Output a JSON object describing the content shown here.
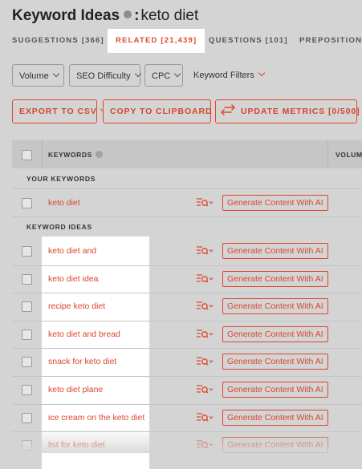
{
  "header": {
    "title_main": "Keyword Ideas",
    "title_sep": ":",
    "title_query": "keto diet"
  },
  "tabs": [
    {
      "label": "SUGGESTIONS [366]",
      "active": false
    },
    {
      "label": "RELATED [21,439]",
      "active": true
    },
    {
      "label": "QUESTIONS [101]",
      "active": false
    },
    {
      "label": "PREPOSITIONS",
      "active": false
    }
  ],
  "filters": {
    "volume": "Volume",
    "seo_difficulty": "SEO Difficulty",
    "cpc": "CPC",
    "keyword_filters": "Keyword Filters"
  },
  "actions": {
    "export": "EXPORT TO CSV",
    "clipboard": "COPY TO CLIPBOARD",
    "update": "UPDATE METRICS [0/500]"
  },
  "table": {
    "col_keywords": "KEYWORDS",
    "col_volume": "VOLUM",
    "section_yours": "YOUR KEYWORDS",
    "section_ideas": "KEYWORD IDEAS",
    "your_keywords": [
      "keto diet"
    ],
    "keyword_ideas": [
      "keto diet and",
      "keto diet idea",
      "recipe keto diet",
      "keto diet and bread",
      "snack for keto diet",
      "keto diet plane",
      "ice cream on the keto diet",
      "list for keto diet"
    ],
    "generate_label": "Generate Content With AI"
  },
  "colors": {
    "accent": "#e0472b",
    "background": "#d4d4d4",
    "highlight": "#ffffff"
  },
  "icons": {
    "tool": "list-search-icon",
    "help": "help-circle-icon",
    "info": "info-dot-icon"
  }
}
